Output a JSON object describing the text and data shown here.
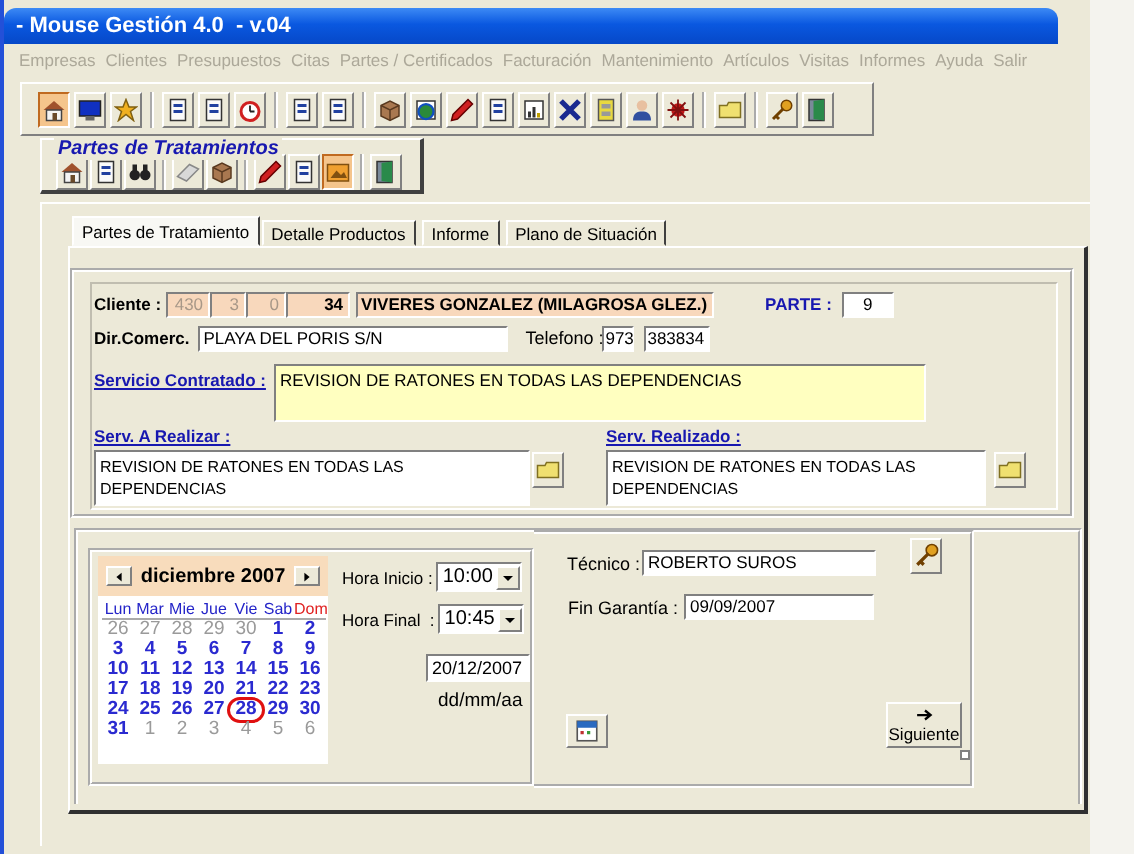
{
  "window": {
    "title": "- Mouse Gestión 4.0  - v.04"
  },
  "menu": [
    {
      "label": "Empresas",
      "disabled": true
    },
    {
      "label": "Clientes",
      "disabled": true
    },
    {
      "label": "Presupuestos",
      "disabled": true
    },
    {
      "label": "Citas",
      "disabled": true
    },
    {
      "label": "Partes / Certificados",
      "disabled": true
    },
    {
      "label": "Facturación",
      "disabled": true
    },
    {
      "label": "Mantenimiento",
      "disabled": true
    },
    {
      "label": "Artículos",
      "disabled": true
    },
    {
      "label": "Visitas",
      "disabled": true
    },
    {
      "label": "Informes",
      "disabled": true
    },
    {
      "label": "Ayuda",
      "disabled": true
    },
    {
      "label": "Salir",
      "disabled": true
    }
  ],
  "toolbar": {
    "groups": [
      {
        "buttons": [
          {
            "pressed": true
          },
          {
            "pressed": false
          },
          {
            "pressed": false
          }
        ]
      },
      {
        "buttons": [
          {
            "pressed": false
          },
          {
            "pressed": false
          },
          {
            "pressed": false
          }
        ]
      },
      {
        "buttons": [
          {
            "pressed": false
          },
          {
            "pressed": false
          }
        ]
      },
      {
        "buttons": [
          {
            "pressed": false
          },
          {
            "pressed": false
          },
          {
            "pressed": false
          },
          {
            "pressed": false
          },
          {
            "pressed": false
          },
          {
            "pressed": false
          },
          {
            "pressed": false
          },
          {
            "pressed": false
          },
          {
            "pressed": false
          }
        ]
      },
      {
        "buttons": [
          {
            "pressed": false
          }
        ]
      },
      {
        "buttons": [
          {
            "pressed": false
          },
          {
            "pressed": false
          }
        ]
      }
    ]
  },
  "treatments_toolbar": {
    "title": "Partes de Tratamientos",
    "groups": [
      {
        "buttons": [
          {
            "pressed": false
          },
          {
            "pressed": false
          },
          {
            "pressed": false
          }
        ]
      },
      {
        "buttons": [
          {
            "pressed": false
          },
          {
            "pressed": false
          }
        ]
      },
      {
        "buttons": [
          {
            "pressed": false
          },
          {
            "pressed": false
          },
          {
            "pressed": true
          }
        ]
      },
      {
        "buttons": [
          {
            "pressed": false
          }
        ]
      }
    ]
  },
  "tabs": [
    {
      "label": "Partes de Tratamiento",
      "selected": true
    },
    {
      "label": "Detalle Productos",
      "selected": false
    },
    {
      "label": "Informe",
      "selected": false
    },
    {
      "label": "Plano de Situación",
      "selected": false
    }
  ],
  "client": {
    "label": "Cliente :",
    "codes": [
      {
        "value": "430",
        "disabled": true
      },
      {
        "value": "3",
        "disabled": true
      },
      {
        "value": "0",
        "disabled": true
      },
      {
        "value": "34",
        "disabled": false
      }
    ],
    "name": "VIVERES GONZALEZ  (MILAGROSA GLEZ.)"
  },
  "parte": {
    "label": "PARTE :",
    "value": "9"
  },
  "address": {
    "label": "Dir.Comerc.",
    "value": "PLAYA DEL PORIS S/N"
  },
  "phone": {
    "label": "Telefono :",
    "prefix": "973",
    "number": "383834"
  },
  "contracted_service": {
    "label": "Servicio Contratado :",
    "value": "REVISION DE RATONES EN TODAS LAS DEPENDENCIAS"
  },
  "service_to_do": {
    "label": "Serv. A Realizar  :",
    "value": "REVISION DE RATONES EN TODAS LAS DEPENDENCIAS"
  },
  "service_done": {
    "label": "Serv. Realizado :",
    "value": "REVISION DE RATONES EN TODAS LAS DEPENDENCIAS"
  },
  "calendar": {
    "month": "diciembre 2007",
    "weekdays": [
      {
        "label": "Lun",
        "color": "#2424c8"
      },
      {
        "label": "Mar",
        "color": "#2424c8"
      },
      {
        "label": "Mie",
        "color": "#2424c8"
      },
      {
        "label": "Jue",
        "color": "#2424c8"
      },
      {
        "label": "Vie",
        "color": "#2424c8"
      },
      {
        "label": "Sab",
        "color": "#2424c8"
      },
      {
        "label": "Dom",
        "color": "#e02020"
      }
    ],
    "weeks": [
      [
        {
          "day": "26",
          "muted": true,
          "today": false
        },
        {
          "day": "27",
          "muted": true,
          "today": false
        },
        {
          "day": "28",
          "muted": true,
          "today": false
        },
        {
          "day": "29",
          "muted": true,
          "today": false
        },
        {
          "day": "30",
          "muted": true,
          "today": false
        },
        {
          "day": "1",
          "muted": false,
          "today": false
        },
        {
          "day": "2",
          "muted": false,
          "today": false
        }
      ],
      [
        {
          "day": "3",
          "muted": false,
          "today": false
        },
        {
          "day": "4",
          "muted": false,
          "today": false
        },
        {
          "day": "5",
          "muted": false,
          "today": false
        },
        {
          "day": "6",
          "muted": false,
          "today": false
        },
        {
          "day": "7",
          "muted": false,
          "today": false
        },
        {
          "day": "8",
          "muted": false,
          "today": false
        },
        {
          "day": "9",
          "muted": false,
          "today": false
        }
      ],
      [
        {
          "day": "10",
          "muted": false,
          "today": false
        },
        {
          "day": "11",
          "muted": false,
          "today": false
        },
        {
          "day": "12",
          "muted": false,
          "today": false
        },
        {
          "day": "13",
          "muted": false,
          "today": false
        },
        {
          "day": "14",
          "muted": false,
          "today": false
        },
        {
          "day": "15",
          "muted": false,
          "today": false
        },
        {
          "day": "16",
          "muted": false,
          "today": false
        }
      ],
      [
        {
          "day": "17",
          "muted": false,
          "today": false
        },
        {
          "day": "18",
          "muted": false,
          "today": false
        },
        {
          "day": "19",
          "muted": false,
          "today": false
        },
        {
          "day": "20",
          "muted": false,
          "today": false
        },
        {
          "day": "21",
          "muted": false,
          "today": false
        },
        {
          "day": "22",
          "muted": false,
          "today": false
        },
        {
          "day": "23",
          "muted": false,
          "today": false
        }
      ],
      [
        {
          "day": "24",
          "muted": false,
          "today": false
        },
        {
          "day": "25",
          "muted": false,
          "today": false
        },
        {
          "day": "26",
          "muted": false,
          "today": false
        },
        {
          "day": "27",
          "muted": false,
          "today": false
        },
        {
          "day": "28",
          "muted": false,
          "today": true
        },
        {
          "day": "29",
          "muted": false,
          "today": false
        },
        {
          "day": "30",
          "muted": false,
          "today": false
        }
      ],
      [
        {
          "day": "31",
          "muted": false,
          "today": false
        },
        {
          "day": "1",
          "muted": true,
          "today": false
        },
        {
          "day": "2",
          "muted": true,
          "today": false
        },
        {
          "day": "3",
          "muted": true,
          "today": false
        },
        {
          "day": "4",
          "muted": true,
          "today": false
        },
        {
          "day": "5",
          "muted": true,
          "today": false
        },
        {
          "day": "6",
          "muted": true,
          "today": false
        }
      ]
    ]
  },
  "start_time": {
    "label": "Hora Inicio :",
    "value": "10:00"
  },
  "end_time": {
    "label": "Hora Final  :",
    "value": "10:45"
  },
  "date": {
    "value": "20/12/2007",
    "format": "dd/mm/aa"
  },
  "technician": {
    "label": "Técnico :",
    "value": "ROBERTO SUROS"
  },
  "warranty_end": {
    "label": "Fin Garantía :",
    "value": "09/09/2007"
  },
  "next_button": {
    "label": "Siguiente"
  }
}
